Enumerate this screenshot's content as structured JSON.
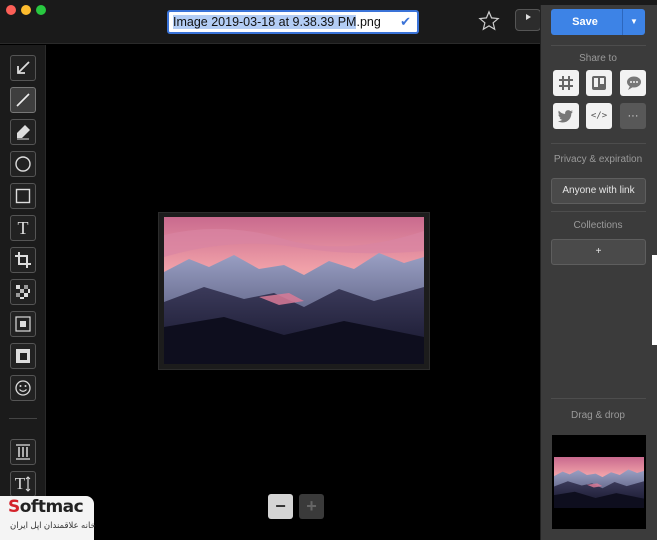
{
  "window": {
    "filename_selected": "Image 2019-03-18 at 9.38.39 PM",
    "filename_ext": ".png",
    "check_glyph": "✔"
  },
  "toolbar": {
    "tools": [
      "arrow-icon",
      "line-icon",
      "highlighter-icon",
      "ellipse-icon",
      "rectangle-icon",
      "text-icon",
      "crop-icon",
      "pixelate-icon",
      "blur-icon",
      "spotlight-icon",
      "emoji-icon",
      "resize-height-icon",
      "text-size-icon"
    ],
    "text_tool_label": "T",
    "text_size_label": "T"
  },
  "canvas": {
    "zoom_out_label": "−",
    "zoom_in_label": "+"
  },
  "panel": {
    "save_label": "Save",
    "save_dropdown": "▼",
    "share_label": "Share to",
    "embed_label": "</>",
    "more_label": "···",
    "privacy_label": "Privacy & expiration",
    "privacy_value": "Anyone with link",
    "collections_label": "Collections",
    "add_collection": "+",
    "drag_label": "Drag & drop"
  },
  "watermark": {
    "brand_s": "S",
    "brand_rest": "oftmac",
    "tagline": "خانه علاقمندان اپل ایران"
  },
  "colors": {
    "accent": "#3d83e6",
    "panel": "#3b3b3b",
    "toolbar": "#1b1b1b"
  }
}
